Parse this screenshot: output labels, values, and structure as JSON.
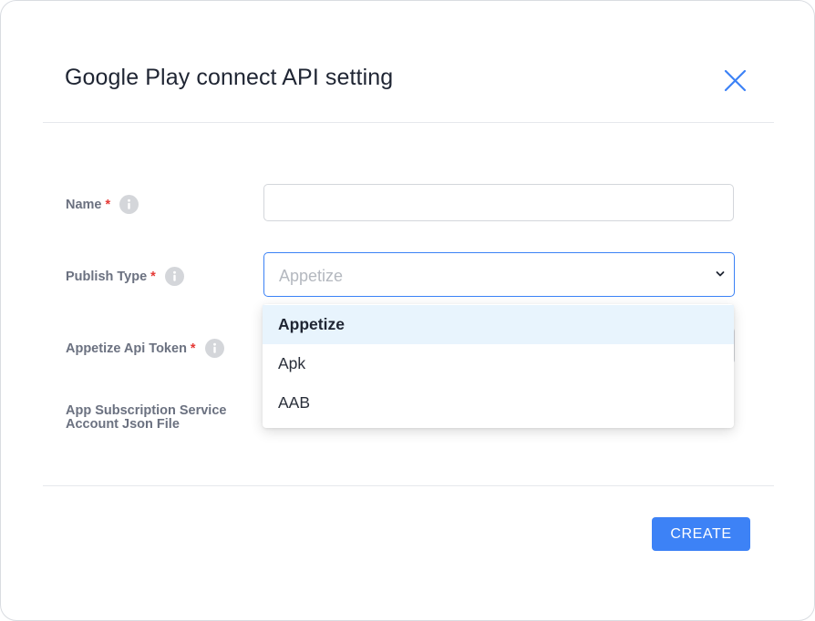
{
  "dialog": {
    "title": "Google Play connect API setting"
  },
  "form": {
    "name": {
      "label": "Name",
      "required_mark": "*",
      "value": ""
    },
    "publish_type": {
      "label": "Publish Type",
      "required_mark": "*",
      "selected": "Appetize",
      "options": [
        "Appetize",
        "Apk",
        "AAB"
      ]
    },
    "appetize_api_token": {
      "label": "Appetize Api Token",
      "required_mark": "*"
    },
    "subscription_file": {
      "label_line1": "App Subscription Service",
      "label_line2": "Account Json File"
    }
  },
  "footer": {
    "create_label": "CREATE"
  },
  "colors": {
    "accent": "#3d82f6",
    "required": "#e53935",
    "option_highlight": "#e8f4fd"
  },
  "icons": {
    "close": "close-icon",
    "info": "info-icon",
    "dropdown": "chevron-down-icon"
  }
}
